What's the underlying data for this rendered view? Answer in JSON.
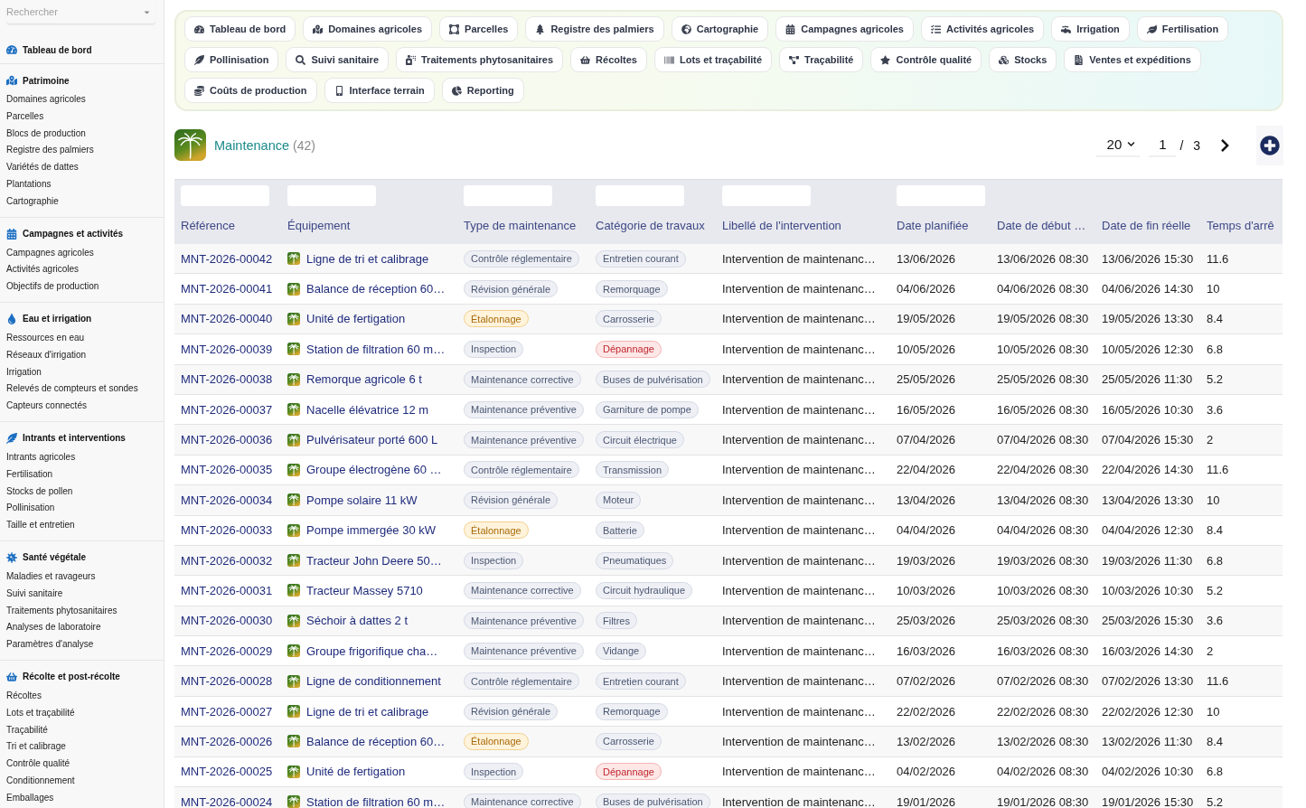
{
  "sidebar": {
    "search": {
      "placeholder": "Rechercher"
    },
    "groups": [
      {
        "title": "Tableau de bord"
      },
      {
        "title": "Patrimoine",
        "items": [
          "Domaines agricoles",
          "Parcelles",
          "Blocs de production",
          "Registre des palmiers",
          "Variétés de dattes",
          "Plantations",
          "Cartographie"
        ]
      },
      {
        "title": "Campagnes et activités",
        "items": [
          "Campagnes agricoles",
          "Activités agricoles",
          "Objectifs de production"
        ]
      },
      {
        "title": "Eau et irrigation",
        "items": [
          "Ressources en eau",
          "Réseaux d'irrigation",
          "Irrigation",
          "Relevés de compteurs et sondes",
          "Capteurs connectés"
        ]
      },
      {
        "title": "Intrants et interventions",
        "items": [
          "Intrants agricoles",
          "Fertilisation",
          "Stocks de pollen",
          "Pollinisation",
          "Taille et entretien"
        ]
      },
      {
        "title": "Santé végétale",
        "items": [
          "Maladies et ravageurs",
          "Suivi sanitaire",
          "Traitements phytosanitaires",
          "Analyses de laboratoire",
          "Paramètres d'analyse"
        ]
      },
      {
        "title": "Récolte et post-récolte",
        "items": [
          "Récoltes",
          "Lots et traçabilité",
          "Traçabilité",
          "Tri et calibrage",
          "Contrôle qualité",
          "Conditionnement",
          "Emballages"
        ]
      }
    ]
  },
  "nav": {
    "buttons": [
      "Tableau de bord",
      "Domaines agricoles",
      "Parcelles",
      "Registre des palmiers",
      "Cartographie",
      "Campagnes agricoles",
      "Activités agricoles",
      "Irrigation",
      "Fertilisation",
      "Pollinisation",
      "Suivi sanitaire",
      "Traitements phytosanitaires",
      "Récoltes",
      "Lots et traçabilité",
      "Traçabilité",
      "Contrôle qualité",
      "Stocks",
      "Ventes et expéditions",
      "Coûts de production",
      "Interface terrain",
      "Reporting"
    ]
  },
  "header": {
    "title": "Maintenance",
    "count": "(42)",
    "page_size": "20",
    "page": "1",
    "page_of": "/ 3"
  },
  "table": {
    "columns": [
      {
        "label": "Référence",
        "filterable": true
      },
      {
        "label": "Équipement",
        "filterable": true
      },
      {
        "label": "Type de maintenance",
        "filterable": true
      },
      {
        "label": "Catégorie de travaux",
        "filterable": true
      },
      {
        "label": "Libellé de l'intervention",
        "filterable": true
      },
      {
        "label": "Date planifiée",
        "filterable": true
      },
      {
        "label": "Date de début …",
        "filterable": false
      },
      {
        "label": "Date de fin réelle",
        "filterable": false
      },
      {
        "label": "Temps d'arrê",
        "filterable": false
      }
    ],
    "rows": [
      {
        "reference": "MNT-2026-00042",
        "equipment": "Ligne de tri et calibrage",
        "type": {
          "label": "Contrôle réglementaire",
          "color": "#4b5672"
        },
        "category": {
          "label": "Entretien courant",
          "color": "#4b5672"
        },
        "description": "Intervention de maintenanc…",
        "planned": "13/06/2026",
        "start": "13/06/2026 08:30",
        "end": "13/06/2026 15:30",
        "downtime": "11.6"
      },
      {
        "reference": "MNT-2026-00041",
        "equipment": "Balance de réception 60…",
        "type": {
          "label": "Révision générale",
          "color": "#4b5672"
        },
        "category": {
          "label": "Remorquage",
          "color": "#4b5672"
        },
        "description": "Intervention de maintenanc…",
        "planned": "04/06/2026",
        "start": "04/06/2026 08:30",
        "end": "04/06/2026 14:30",
        "downtime": "10"
      },
      {
        "reference": "MNT-2026-00040",
        "equipment": "Unité de fertigation",
        "type": {
          "label": "Étalonnage",
          "color": "#a86a08"
        },
        "category": {
          "label": "Carrosserie",
          "color": "#4b5672"
        },
        "description": "Intervention de maintenanc…",
        "planned": "19/05/2026",
        "start": "19/05/2026 08:30",
        "end": "19/05/2026 13:30",
        "downtime": "8.4"
      },
      {
        "reference": "MNT-2026-00039",
        "equipment": "Station de filtration 60 m…",
        "type": {
          "label": "Inspection",
          "color": "#4b5672"
        },
        "category": {
          "label": "Dépannage",
          "color": "#c0262d"
        },
        "description": "Intervention de maintenanc…",
        "planned": "10/05/2026",
        "start": "10/05/2026 08:30",
        "end": "10/05/2026 12:30",
        "downtime": "6.8"
      },
      {
        "reference": "MNT-2026-00038",
        "equipment": "Remorque agricole 6 t",
        "type": {
          "label": "Maintenance corrective",
          "color": "#4b5672"
        },
        "category": {
          "label": "Buses de pulvérisation",
          "color": "#4b5672"
        },
        "description": "Intervention de maintenanc…",
        "planned": "25/05/2026",
        "start": "25/05/2026 08:30",
        "end": "25/05/2026 11:30",
        "downtime": "5.2"
      },
      {
        "reference": "MNT-2026-00037",
        "equipment": "Nacelle élévatrice 12 m",
        "type": {
          "label": "Maintenance préventive",
          "color": "#4b5672"
        },
        "category": {
          "label": "Garniture de pompe",
          "color": "#4b5672"
        },
        "description": "Intervention de maintenanc…",
        "planned": "16/05/2026",
        "start": "16/05/2026 08:30",
        "end": "16/05/2026 10:30",
        "downtime": "3.6"
      },
      {
        "reference": "MNT-2026-00036",
        "equipment": "Pulvérisateur porté 600 L",
        "type": {
          "label": "Maintenance préventive",
          "color": "#4b5672"
        },
        "category": {
          "label": "Circuit électrique",
          "color": "#4b5672"
        },
        "description": "Intervention de maintenanc…",
        "planned": "07/04/2026",
        "start": "07/04/2026 08:30",
        "end": "07/04/2026 15:30",
        "downtime": "2"
      },
      {
        "reference": "MNT-2026-00035",
        "equipment": "Groupe électrogène 60 …",
        "type": {
          "label": "Contrôle réglementaire",
          "color": "#4b5672"
        },
        "category": {
          "label": "Transmission",
          "color": "#4b5672"
        },
        "description": "Intervention de maintenanc…",
        "planned": "22/04/2026",
        "start": "22/04/2026 08:30",
        "end": "22/04/2026 14:30",
        "downtime": "11.6"
      },
      {
        "reference": "MNT-2026-00034",
        "equipment": "Pompe solaire 11 kW",
        "type": {
          "label": "Révision générale",
          "color": "#4b5672"
        },
        "category": {
          "label": "Moteur",
          "color": "#4b5672"
        },
        "description": "Intervention de maintenanc…",
        "planned": "13/04/2026",
        "start": "13/04/2026 08:30",
        "end": "13/04/2026 13:30",
        "downtime": "10"
      },
      {
        "reference": "MNT-2026-00033",
        "equipment": "Pompe immergée 30 kW",
        "type": {
          "label": "Étalonnage",
          "color": "#a86a08"
        },
        "category": {
          "label": "Batterie",
          "color": "#4b5672"
        },
        "description": "Intervention de maintenanc…",
        "planned": "04/04/2026",
        "start": "04/04/2026 08:30",
        "end": "04/04/2026 12:30",
        "downtime": "8.4"
      },
      {
        "reference": "MNT-2026-00032",
        "equipment": "Tracteur John Deere 50…",
        "type": {
          "label": "Inspection",
          "color": "#4b5672"
        },
        "category": {
          "label": "Pneumatiques",
          "color": "#4b5672"
        },
        "description": "Intervention de maintenanc…",
        "planned": "19/03/2026",
        "start": "19/03/2026 08:30",
        "end": "19/03/2026 11:30",
        "downtime": "6.8"
      },
      {
        "reference": "MNT-2026-00031",
        "equipment": "Tracteur Massey 5710",
        "type": {
          "label": "Maintenance corrective",
          "color": "#4b5672"
        },
        "category": {
          "label": "Circuit hydraulique",
          "color": "#4b5672"
        },
        "description": "Intervention de maintenanc…",
        "planned": "10/03/2026",
        "start": "10/03/2026 08:30",
        "end": "10/03/2026 10:30",
        "downtime": "5.2"
      },
      {
        "reference": "MNT-2026-00030",
        "equipment": "Séchoir à dattes 2 t",
        "type": {
          "label": "Maintenance préventive",
          "color": "#4b5672"
        },
        "category": {
          "label": "Filtres",
          "color": "#4b5672"
        },
        "description": "Intervention de maintenanc…",
        "planned": "25/03/2026",
        "start": "25/03/2026 08:30",
        "end": "25/03/2026 15:30",
        "downtime": "3.6"
      },
      {
        "reference": "MNT-2026-00029",
        "equipment": "Groupe frigorifique cha…",
        "type": {
          "label": "Maintenance préventive",
          "color": "#4b5672"
        },
        "category": {
          "label": "Vidange",
          "color": "#4b5672"
        },
        "description": "Intervention de maintenanc…",
        "planned": "16/03/2026",
        "start": "16/03/2026 08:30",
        "end": "16/03/2026 14:30",
        "downtime": "2"
      },
      {
        "reference": "MNT-2026-00028",
        "equipment": "Ligne de conditionnement",
        "type": {
          "label": "Contrôle réglementaire",
          "color": "#4b5672"
        },
        "category": {
          "label": "Entretien courant",
          "color": "#4b5672"
        },
        "description": "Intervention de maintenanc…",
        "planned": "07/02/2026",
        "start": "07/02/2026 08:30",
        "end": "07/02/2026 13:30",
        "downtime": "11.6"
      },
      {
        "reference": "MNT-2026-00027",
        "equipment": "Ligne de tri et calibrage",
        "type": {
          "label": "Révision générale",
          "color": "#4b5672"
        },
        "category": {
          "label": "Remorquage",
          "color": "#4b5672"
        },
        "description": "Intervention de maintenanc…",
        "planned": "22/02/2026",
        "start": "22/02/2026 08:30",
        "end": "22/02/2026 12:30",
        "downtime": "10"
      },
      {
        "reference": "MNT-2026-00026",
        "equipment": "Balance de réception 60…",
        "type": {
          "label": "Étalonnage",
          "color": "#a86a08"
        },
        "category": {
          "label": "Carrosserie",
          "color": "#4b5672"
        },
        "description": "Intervention de maintenanc…",
        "planned": "13/02/2026",
        "start": "13/02/2026 08:30",
        "end": "13/02/2026 11:30",
        "downtime": "8.4"
      },
      {
        "reference": "MNT-2026-00025",
        "equipment": "Unité de fertigation",
        "type": {
          "label": "Inspection",
          "color": "#4b5672"
        },
        "category": {
          "label": "Dépannage",
          "color": "#c0262d"
        },
        "description": "Intervention de maintenanc…",
        "planned": "04/02/2026",
        "start": "04/02/2026 08:30",
        "end": "04/02/2026 10:30",
        "downtime": "6.8"
      },
      {
        "reference": "MNT-2026-00024",
        "equipment": "Station de filtration 60 m…",
        "type": {
          "label": "Maintenance corrective",
          "color": "#4b5672"
        },
        "category": {
          "label": "Buses de pulvérisation",
          "color": "#4b5672"
        },
        "description": "Intervention de maintenanc…",
        "planned": "19/01/2026",
        "start": "19/01/2026 08:30",
        "end": "19/01/2026 15:30",
        "downtime": "5.2"
      }
    ]
  }
}
